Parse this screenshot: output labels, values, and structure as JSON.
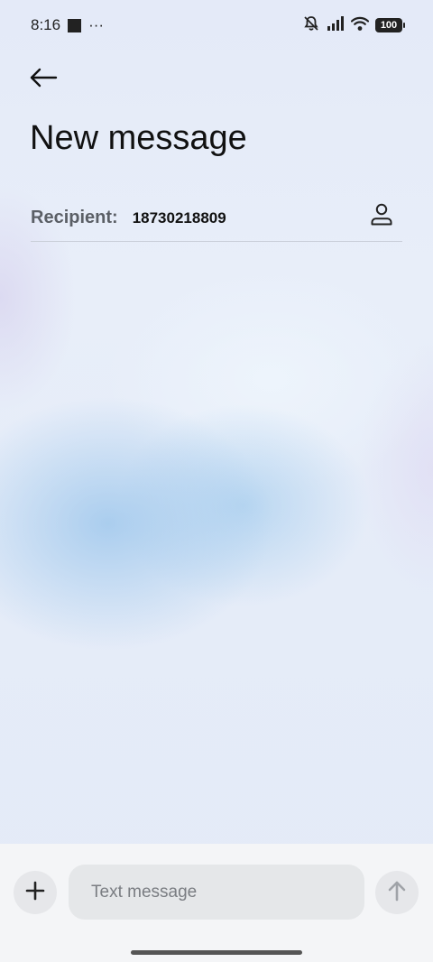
{
  "status_bar": {
    "time": "8:16",
    "more_glyph": "···",
    "battery_level": "100",
    "icons": [
      "notification-square-icon",
      "mute-bell-icon",
      "signal-icon",
      "wifi-icon",
      "battery-icon"
    ]
  },
  "header": {
    "back_icon": "arrow-left-icon",
    "title": "New message"
  },
  "recipient": {
    "label": "Recipient:",
    "value": "18730218809",
    "contact_icon": "person-icon"
  },
  "composer": {
    "add_icon": "plus-icon",
    "placeholder": "Text message",
    "value": "",
    "send_icon": "arrow-up-icon"
  },
  "colors": {
    "background": "#e6ecf7",
    "accent_blue": "#a8cdee",
    "bottom_bar": "#f4f5f7",
    "input_bg": "#e5e7e9",
    "text_primary": "#111111",
    "text_label": "#5b5f66"
  }
}
